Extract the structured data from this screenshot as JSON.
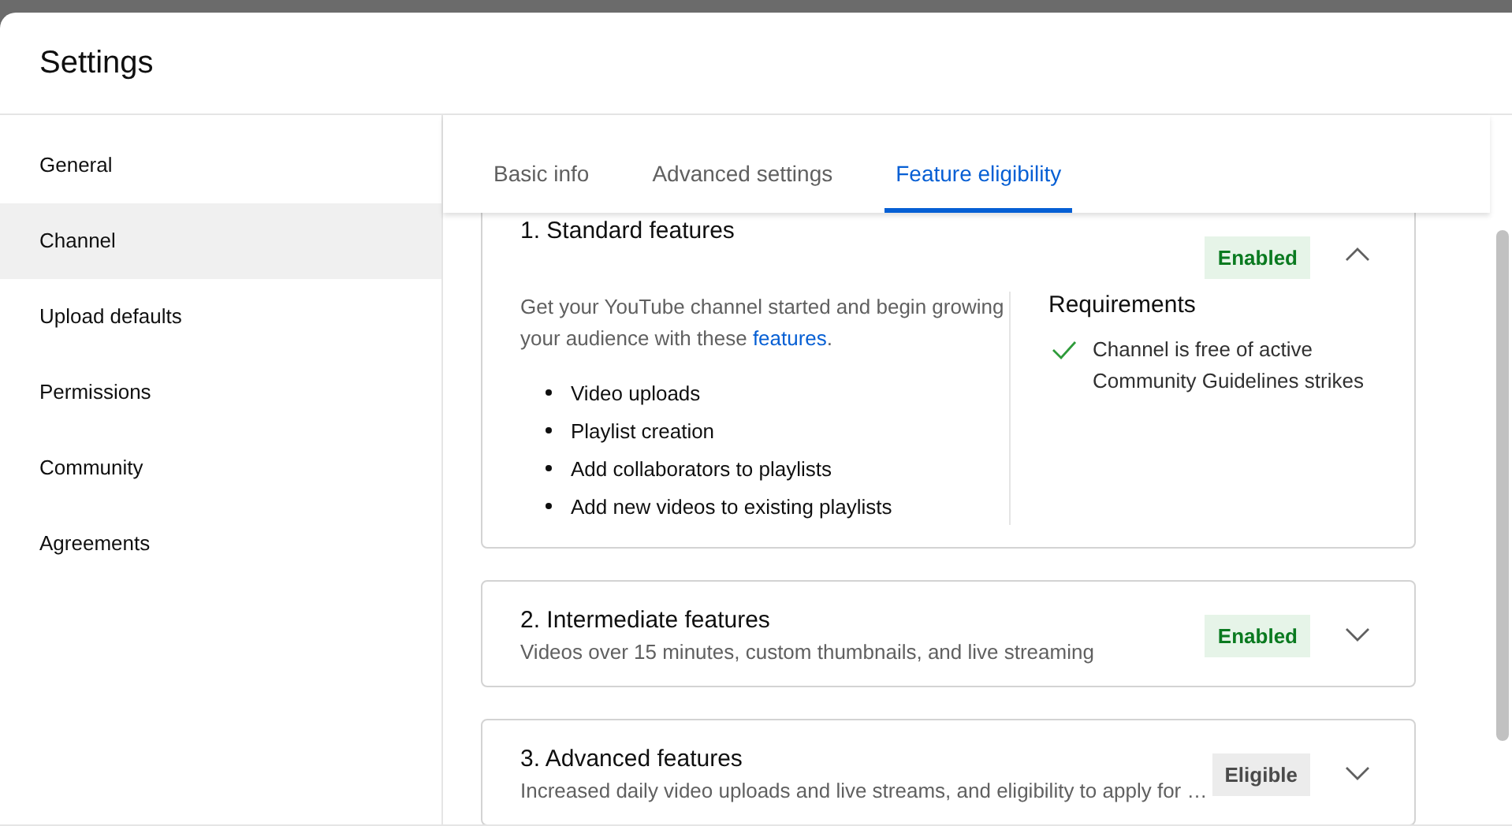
{
  "window": {
    "title": "Settings"
  },
  "sidebar": {
    "items": [
      {
        "label": "General",
        "selected": false
      },
      {
        "label": "Channel",
        "selected": true
      },
      {
        "label": "Upload defaults",
        "selected": false
      },
      {
        "label": "Permissions",
        "selected": false
      },
      {
        "label": "Community",
        "selected": false
      },
      {
        "label": "Agreements",
        "selected": false
      }
    ]
  },
  "tabs": [
    {
      "label": "Basic info",
      "selected": false
    },
    {
      "label": "Advanced settings",
      "selected": false
    },
    {
      "label": "Feature eligibility",
      "selected": true
    }
  ],
  "features": [
    {
      "title": "1. Standard features",
      "status": "Enabled",
      "kind": "enabled",
      "expanded": true,
      "description": "Get your YouTube channel started and begin growing your audience with these ",
      "link": "features",
      "after_link": ".",
      "bullets": [
        "Video uploads",
        "Playlist creation",
        "Add collaborators to playlists",
        "Add new videos to existing playlists"
      ],
      "requirements_title": "Requirements",
      "requirements": [
        {
          "text": "Channel is free of active Community Guidelines strikes",
          "met": true
        }
      ]
    },
    {
      "title": "2. Intermediate features",
      "status": "Enabled",
      "kind": "enabled",
      "expanded": false,
      "subtitle": "Videos over 15 minutes, custom thumbnails, and live streaming"
    },
    {
      "title": "3. Advanced features",
      "status": "Eligible",
      "kind": "eligible",
      "expanded": false,
      "subtitle": "Increased daily video uploads and live streams, and eligibility to apply for …"
    }
  ]
}
